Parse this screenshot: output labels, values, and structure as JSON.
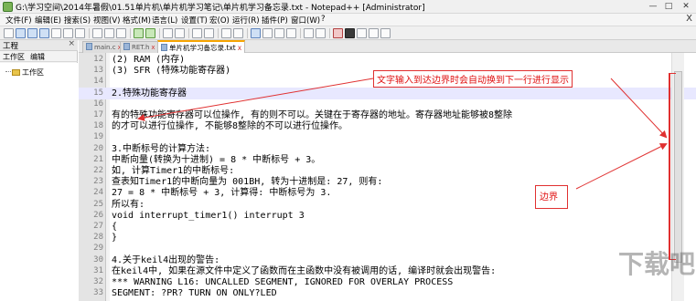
{
  "window": {
    "title": "G:\\学习空间\\2014年暑假\\01.51单片机\\单片机学习笔记\\单片机学习备忘录.txt - Notepad++ [Administrator]",
    "minimize": "—",
    "maximize": "□",
    "close": "✕"
  },
  "menu": {
    "items": [
      "文件(F)",
      "编辑(E)",
      "搜索(S)",
      "视图(V)",
      "格式(M)",
      "语言(L)",
      "设置(T)",
      "宏(O)",
      "运行(R)",
      "插件(P)",
      "窗口(W)",
      "?"
    ],
    "close": "X"
  },
  "panel": {
    "title": "工程",
    "close": "×",
    "menu": [
      "工作区",
      "编辑"
    ],
    "tree_root": "工作区"
  },
  "tabs": [
    {
      "label": "main.c",
      "active": false
    },
    {
      "label": "RET.h",
      "active": false
    },
    {
      "label": "单片机学习备忘录.txt",
      "active": true
    }
  ],
  "tab_close": "x",
  "lines": [
    {
      "num": "12",
      "text": "    (2) RAM (内存)"
    },
    {
      "num": "13",
      "text": "    (3) SFR (特殊功能寄存器)"
    },
    {
      "num": "14",
      "text": ""
    },
    {
      "num": "15",
      "text": "2.特殊功能寄存器"
    },
    {
      "num": "16",
      "text": ""
    },
    {
      "num": "17",
      "text": "      有的特殊功能寄存器可以位操作, 有的则不可以。关键在于寄存器的地址。寄存器地址能够被8整除"
    },
    {
      "num": "18",
      "text": "  的才可以进行位操作, 不能够8整除的不可以进行位操作。"
    },
    {
      "num": "19",
      "text": ""
    },
    {
      "num": "20",
      "text": "3.中断标号的计算方法:"
    },
    {
      "num": "21",
      "text": "  中断向量(转换为十进制) = 8 * 中断标号 + 3。"
    },
    {
      "num": "22",
      "text": "  如, 计算Timer1的中断标号:"
    },
    {
      "num": "23",
      "text": "  查表知Timer1的中断向量为 001BH, 转为十进制是: 27, 则有:"
    },
    {
      "num": "24",
      "text": "  27 = 8 * 中断标号 + 3, 计算得: 中断标号为 3."
    },
    {
      "num": "25",
      "text": "  所以有:"
    },
    {
      "num": "26",
      "text": "        void interrupt_timer1() interrupt 3"
    },
    {
      "num": "27",
      "text": "        {"
    },
    {
      "num": "28",
      "text": "        }"
    },
    {
      "num": "29",
      "text": ""
    },
    {
      "num": "30",
      "text": "4.关于keil4出现的警告:"
    },
    {
      "num": "31",
      "text": "      在keil4中, 如果在源文件中定义了函数而在主函数中没有被调用的话, 编译时就会出现警告:"
    },
    {
      "num": "32",
      "text": "*** WARNING L16: UNCALLED SEGMENT, IGNORED FOR OVERLAY PROCESS"
    },
    {
      "num": "33",
      "text": "SEGMENT: ?PR? TURN ON ONLY?LED"
    }
  ],
  "annotations": {
    "wrap_note": "文字输入到达边界时会自动换到下一行进行显示",
    "edge_note": "边界"
  },
  "colors": {
    "annotation": "#e01010",
    "current_line": "#e8e8ff",
    "active_tab_accent": "#f7a500"
  },
  "watermark": "下载吧"
}
